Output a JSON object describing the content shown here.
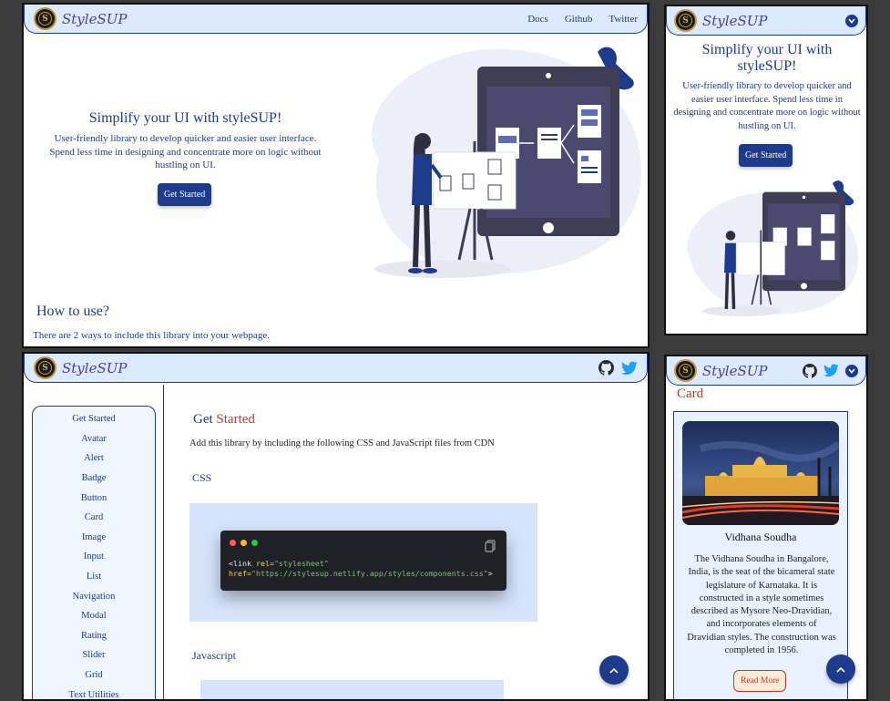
{
  "brand": {
    "name": "StyleSUP",
    "logo_letter": "S"
  },
  "nav": {
    "links": [
      "Docs",
      "Github",
      "Twitter"
    ]
  },
  "hero": {
    "title": "Simplify your UI with styleSUP!",
    "description": "User-friendly library to develop quicker and easier user interface. Spend less time in designing and concentrate more on logic without hustling on UI.",
    "cta_label": "Get Started"
  },
  "how_to_use": {
    "title": "How to use?",
    "description": "There are 2 ways to include this library into your webpage."
  },
  "docs": {
    "sidebar_items": [
      "Get Started",
      "Avatar",
      "Alert",
      "Badge",
      "Button",
      "Card",
      "Image",
      "Input",
      "List",
      "Navigation",
      "Modal",
      "Rating",
      "Slider",
      "Grid",
      "Text Utilities"
    ],
    "heading_prefix": "Get",
    "heading_accent": "Started",
    "description": "Add this library by including the following CSS and JavaScript files from CDN",
    "css_label": "CSS",
    "js_label": "Javascript",
    "code": {
      "tag_open": "<link",
      "attr_rel": "rel=",
      "rel_value": "\"stylesheet\"",
      "attr_href": "href=",
      "href_value": "\"https://stylesup.netlify.app/styles/components.css\"",
      "tag_close": ">"
    }
  },
  "card_demo": {
    "heading": "Card",
    "title": "Vidhana Soudha",
    "text": "The Vidhana Soudha in Bangalore, India, is the seat of the bicameral state legislature of Karnataka. It is constructed in a style sometimes described as Mysore Neo-Dravidian, and incorporates elements of Dravidian styles. The construction was completed in 1956.",
    "button_label": "Read More"
  },
  "icons": {
    "github": "github-icon",
    "twitter": "twitter-icon",
    "menu": "chevron-down-icon",
    "copy": "copy-icon",
    "scroll_top": "arrow-up-icon"
  },
  "colors": {
    "primary": "#1e3a8a",
    "accent": "#c0392b",
    "nav_bg": "#dceaff",
    "card_bg": "#e8f1ff"
  }
}
